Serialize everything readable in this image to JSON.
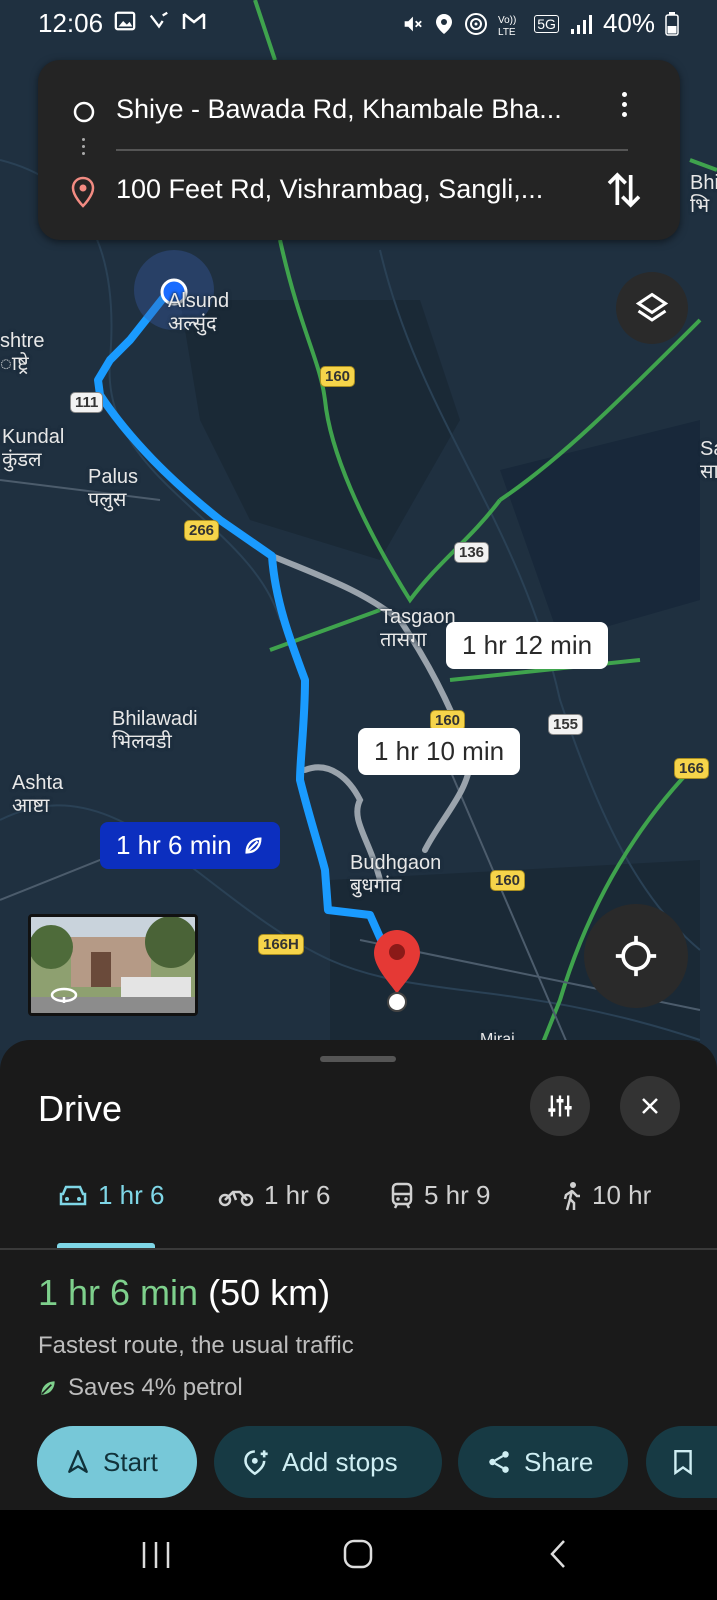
{
  "status_bar": {
    "time": "12:06",
    "battery": "40%",
    "network": "5G"
  },
  "route": {
    "origin": "Shiye - Bawada Rd, Khambale Bha...",
    "destination": "100 Feet Rd, Vishrambag, Sangli,..."
  },
  "map": {
    "places": [
      {
        "id": "alsund",
        "en": "Alsund",
        "mr": "अल्सुंद"
      },
      {
        "id": "rashtre",
        "en": "shtre",
        "mr": "ाष्ट्रे"
      },
      {
        "id": "kundal",
        "en": "Kundal",
        "mr": "कुंडल"
      },
      {
        "id": "palus",
        "en": "Palus",
        "mr": "पलुस"
      },
      {
        "id": "tasgaon",
        "en": "Tasgaon",
        "mr": "तासगा"
      },
      {
        "id": "bhilawadi",
        "en": "Bhilawadi",
        "mr": "भिलवडी"
      },
      {
        "id": "ashta",
        "en": "Ashta",
        "mr": "आष्टा"
      },
      {
        "id": "budhgaon",
        "en": "Budhgaon",
        "mr": "बुधगांव"
      },
      {
        "id": "miraj",
        "en": "Miraj",
        "mr": ""
      },
      {
        "id": "bhi",
        "en": "Bhi",
        "mr": "भि"
      },
      {
        "id": "sa",
        "en": "Sa",
        "mr": "सा"
      }
    ],
    "shields": [
      "111",
      "160",
      "266",
      "136",
      "160",
      "155",
      "166",
      "160",
      "166H"
    ],
    "route_times": {
      "alt1": "1 hr 12 min",
      "alt2": "1 hr 10 min",
      "main": "1 hr 6 min"
    }
  },
  "sheet": {
    "title": "Drive",
    "modes": [
      {
        "icon": "car-icon",
        "label": "1 hr 6",
        "active": true
      },
      {
        "icon": "motorcycle-icon",
        "label": "1 hr 6"
      },
      {
        "icon": "transit-icon",
        "label": "5 hr 9"
      },
      {
        "icon": "walk-icon",
        "label": "10 hr"
      }
    ],
    "duration": "1 hr 6 min",
    "distance": "(50 km)",
    "subtitle": "Fastest route, the usual traffic",
    "saves": "Saves 4% petrol",
    "buttons": {
      "start": "Start",
      "add_stops": "Add stops",
      "share": "Share"
    }
  },
  "colors": {
    "accent": "#77c8d8",
    "route": "#1a9bff",
    "duration": "#7ed08c",
    "pin": "#e53935"
  }
}
